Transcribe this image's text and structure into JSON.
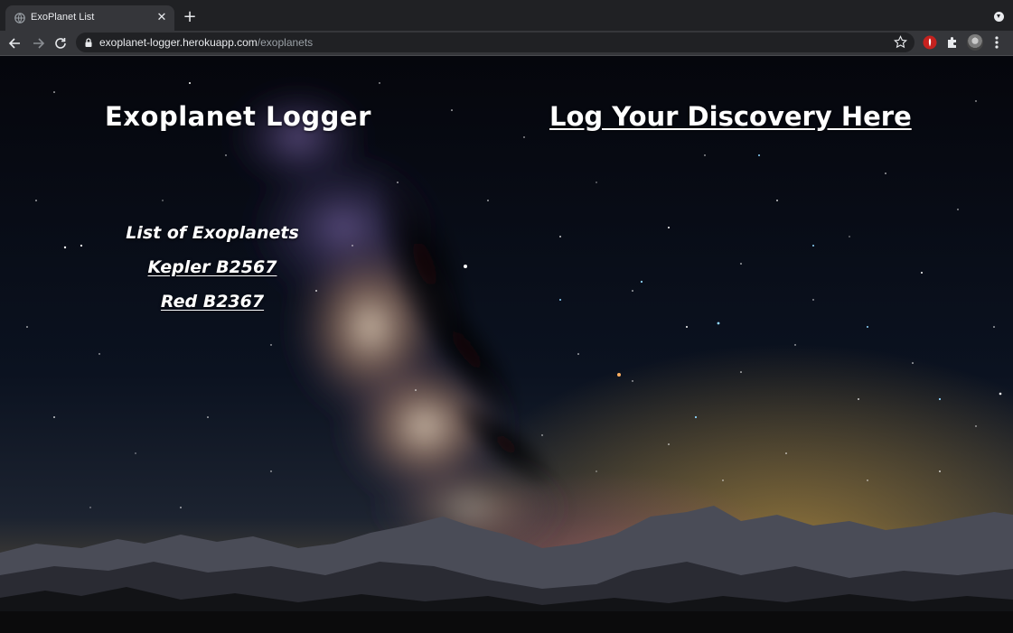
{
  "browser": {
    "tab_title": "ExoPlanet List",
    "tab_close": "✕",
    "new_tab": "+",
    "url_host": "exoplanet-logger.herokuapp.com",
    "url_path": "/exoplanets"
  },
  "page": {
    "site_title": "Exoplanet Logger",
    "cta_link": "Log Your Discovery Here",
    "list_heading": "List of Exoplanets",
    "planets": [
      {
        "name": "Kepler B2567"
      },
      {
        "name": "Red B2367"
      }
    ]
  },
  "colors": {
    "chrome_bg": "#202124",
    "toolbar_bg": "#35363a",
    "text": "#ffffff"
  }
}
